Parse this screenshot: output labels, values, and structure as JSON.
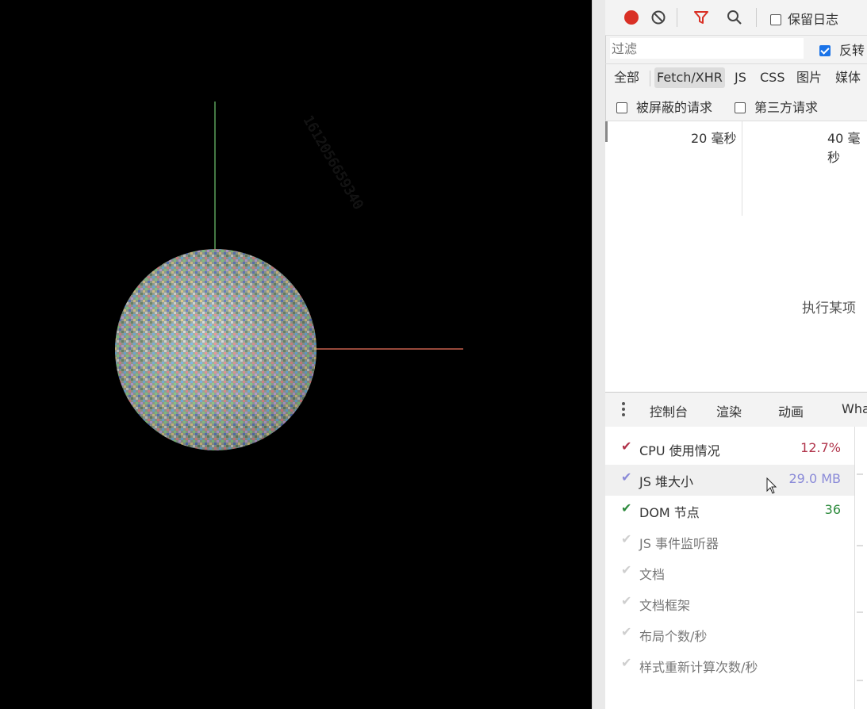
{
  "canvas": {
    "watermark_text": "1612056659340",
    "sphere_colors": [
      "#6fb8e8",
      "#e88a8a",
      "#8ad88a",
      "#c9a6e8",
      "#e8d28a",
      "#b8b8b8"
    ],
    "axis_y_color": "#5aa05a",
    "axis_x_color": "#c8604e"
  },
  "toolbar": {
    "record_icon": "record-icon",
    "clear_icon": "clear-icon",
    "filter_icon": "filter-icon",
    "search_icon": "search-icon",
    "preserve_log_label": "保留日志",
    "preserve_log_checked": false
  },
  "filter": {
    "placeholder": "过滤",
    "invert_label": "反转",
    "invert_checked": true
  },
  "types": [
    "全部",
    "Fetch/XHR",
    "JS",
    "CSS",
    "图片",
    "媒体"
  ],
  "active_type": "Fetch/XHR",
  "blocked": {
    "blocked_requests_label": "被屏蔽的请求",
    "third_party_label": "第三方请求"
  },
  "timeline": {
    "labels": [
      "20 毫秒",
      "40 毫秒"
    ]
  },
  "main": {
    "message": "执行某项"
  },
  "drawer": {
    "tabs": [
      "控制台",
      "渲染",
      "动画",
      "What's New"
    ]
  },
  "perf_monitor": {
    "items": [
      {
        "label": "CPU 使用情况",
        "value": "12.7%",
        "checked": true,
        "color": "#b0334a"
      },
      {
        "label": "JS 堆大小",
        "value": "29.0 MB",
        "checked": true,
        "color": "#8a8ad8"
      },
      {
        "label": "DOM 节点",
        "value": "36",
        "checked": true,
        "color": "#2e8b3e"
      },
      {
        "label": "JS 事件监听器",
        "value": "",
        "checked": false,
        "color": "#cccccc"
      },
      {
        "label": "文档",
        "value": "",
        "checked": false,
        "color": "#cccccc"
      },
      {
        "label": "文档框架",
        "value": "",
        "checked": false,
        "color": "#cccccc"
      },
      {
        "label": "布局个数/秒",
        "value": "",
        "checked": false,
        "color": "#cccccc"
      },
      {
        "label": "样式重新计算次数/秒",
        "value": "",
        "checked": false,
        "color": "#cccccc"
      }
    ]
  }
}
